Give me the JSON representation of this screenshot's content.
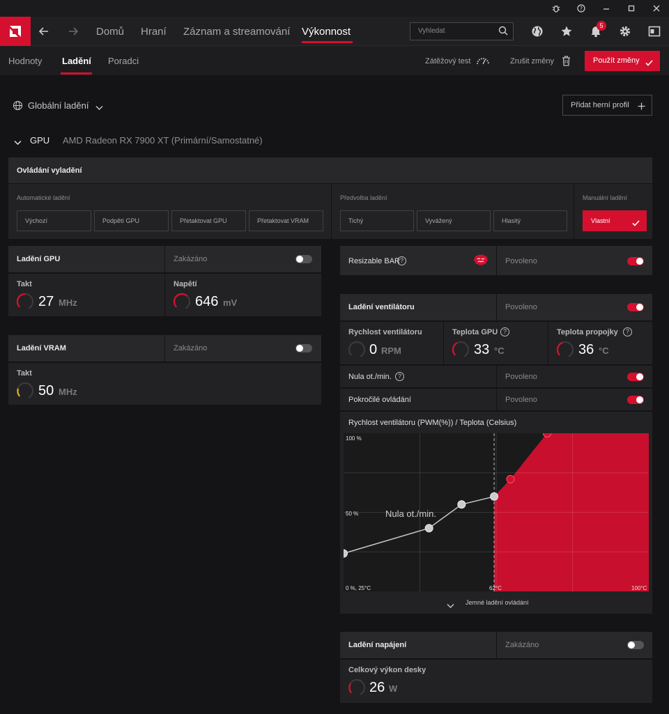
{
  "titlebar": {
    "icons": [
      "bug-icon",
      "help-icon",
      "minimize-icon",
      "maximize-icon",
      "close-icon"
    ]
  },
  "nav": {
    "tabs": [
      "Domů",
      "Hraní",
      "Záznam a streamování",
      "Výkonnost"
    ],
    "active_tab": "Výkonnost",
    "search_placeholder": "Vyhledat",
    "notification_count": "5"
  },
  "subnav": {
    "tabs": [
      "Hodnoty",
      "Ladění",
      "Poradci"
    ],
    "active_tab": "Ladění",
    "stress_test": "Zátěžový test",
    "undo": "Zrušit změny",
    "apply": "Použít změny"
  },
  "profile": {
    "scope": "Globální ladění",
    "add_profile": "Přidat herní profil"
  },
  "gpu": {
    "label": "GPU",
    "name": "AMD Radeon RX 7900 XT (Primární/Samostatné)"
  },
  "tuning_control": {
    "title": "Ovládání vyladění",
    "auto": {
      "label": "Automatické ladění",
      "options": [
        "Výchozí",
        "Podpětí GPU",
        "Přetaktovat GPU",
        "Přetaktovat VRAM"
      ]
    },
    "preset": {
      "label": "Předvolba ladění",
      "options": [
        "Tichý",
        "Vyvážený",
        "Hlasitý"
      ]
    },
    "manual": {
      "label": "Manuální ladění",
      "selected": "Vlastní"
    }
  },
  "gpu_tuning": {
    "title": "Ladění GPU",
    "state": "Zakázáno",
    "enabled": false,
    "clock": {
      "label": "Takt",
      "value": "27",
      "unit": "MHz"
    },
    "voltage": {
      "label": "Napětí",
      "value": "646",
      "unit": "mV"
    }
  },
  "vram_tuning": {
    "title": "Ladění VRAM",
    "state": "Zakázáno",
    "enabled": false,
    "clock": {
      "label": "Takt",
      "value": "50",
      "unit": "MHz"
    }
  },
  "resizable_bar": {
    "title": "Resizable BAR",
    "state": "Povoleno",
    "enabled": true
  },
  "fan_tuning": {
    "title": "Ladění ventilátoru",
    "state": "Povoleno",
    "enabled": true,
    "fan_speed": {
      "label": "Rychlost ventilátoru",
      "value": "0",
      "unit": "RPM"
    },
    "gpu_temp": {
      "label": "Teplota GPU",
      "value": "33",
      "unit": "°C"
    },
    "junction_temp": {
      "label": "Teplota propojky",
      "value": "36",
      "unit": "°C"
    },
    "zero_rpm": {
      "label": "Nula ot./min.",
      "state": "Povoleno",
      "enabled": true
    },
    "advanced": {
      "label": "Pokročilé ovládání",
      "state": "Povoleno",
      "enabled": true
    },
    "fine_tuning": "Jemné ladění ovládání"
  },
  "chart_data": {
    "type": "line",
    "title": "Rychlost ventilátoru (PWM(%)) / Teplota (Celsius)",
    "xlabel": "",
    "ylabel": "",
    "xlim": [
      25,
      100
    ],
    "ylim": [
      0,
      100
    ],
    "y_tick_labels": [
      "100 %",
      "50 %",
      "0 %, 25°C"
    ],
    "x_tick_labels": [
      "62°C",
      "100°C"
    ],
    "zero_rpm_label": "Nula ot./min.",
    "zero_rpm_threshold": 62,
    "series": [
      {
        "x": [
          25,
          46,
          54,
          62,
          66,
          75
        ],
        "y": [
          24,
          40,
          55,
          60,
          71,
          100
        ]
      }
    ],
    "colors": {
      "curve": "#d5102f",
      "inactive_point": "#cccccc",
      "fill": "#c8102e"
    }
  },
  "power_tuning": {
    "title": "Ladění napájení",
    "state": "Zakázáno",
    "enabled": false,
    "board_power": {
      "label": "Celkový výkon desky",
      "value": "26",
      "unit": "W"
    }
  },
  "colors": {
    "accent": "#d5102f",
    "background": "#141416",
    "panel": "#222224"
  }
}
